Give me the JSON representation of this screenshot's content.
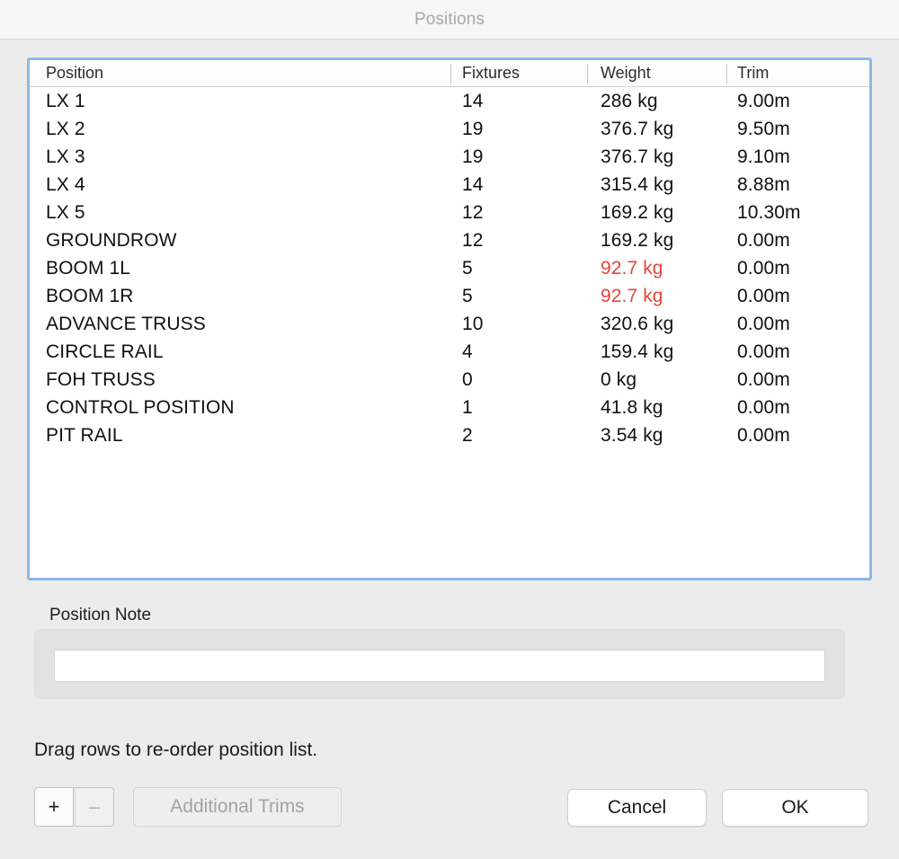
{
  "window": {
    "title": "Positions"
  },
  "table": {
    "columns": [
      "Position",
      "Fixtures",
      "Weight",
      "Trim"
    ],
    "rows": [
      {
        "position": "LX 1",
        "fixtures": "14",
        "weight": "286 kg",
        "trim": "9.00m",
        "weight_alert": false
      },
      {
        "position": "LX 2",
        "fixtures": "19",
        "weight": "376.7 kg",
        "trim": "9.50m",
        "weight_alert": false
      },
      {
        "position": "LX 3",
        "fixtures": "19",
        "weight": "376.7 kg",
        "trim": "9.10m",
        "weight_alert": false
      },
      {
        "position": "LX 4",
        "fixtures": "14",
        "weight": "315.4 kg",
        "trim": "8.88m",
        "weight_alert": false
      },
      {
        "position": "LX 5",
        "fixtures": "12",
        "weight": "169.2 kg",
        "trim": "10.30m",
        "weight_alert": false
      },
      {
        "position": "GROUNDROW",
        "fixtures": "12",
        "weight": "169.2 kg",
        "trim": "0.00m",
        "weight_alert": false
      },
      {
        "position": "BOOM 1L",
        "fixtures": "5",
        "weight": "92.7 kg",
        "trim": "0.00m",
        "weight_alert": true
      },
      {
        "position": "BOOM 1R",
        "fixtures": "5",
        "weight": "92.7 kg",
        "trim": "0.00m",
        "weight_alert": true
      },
      {
        "position": "ADVANCE TRUSS",
        "fixtures": "10",
        "weight": "320.6 kg",
        "trim": "0.00m",
        "weight_alert": false
      },
      {
        "position": "CIRCLE RAIL",
        "fixtures": "4",
        "weight": "159.4 kg",
        "trim": "0.00m",
        "weight_alert": false
      },
      {
        "position": "FOH TRUSS",
        "fixtures": "0",
        "weight": "0 kg",
        "trim": "0.00m",
        "weight_alert": false
      },
      {
        "position": "CONTROL POSITION",
        "fixtures": "1",
        "weight": "41.8 kg",
        "trim": "0.00m",
        "weight_alert": false
      },
      {
        "position": "PIT RAIL",
        "fixtures": "2",
        "weight": "3.54 kg",
        "trim": "0.00m",
        "weight_alert": false
      }
    ]
  },
  "note": {
    "label": "Position Note",
    "value": "",
    "placeholder": ""
  },
  "hint": {
    "text": "Drag rows to re-order position list."
  },
  "buttons": {
    "add": "+",
    "remove": "–",
    "additional_trims": "Additional Trims",
    "cancel": "Cancel",
    "ok": "OK"
  },
  "colors": {
    "alert": "#e8433c",
    "focus_ring": "#8cb9e8",
    "window_bg": "#ececec",
    "titlebar_bg": "#f6f6f6",
    "title_text": "#a8a8a8"
  }
}
